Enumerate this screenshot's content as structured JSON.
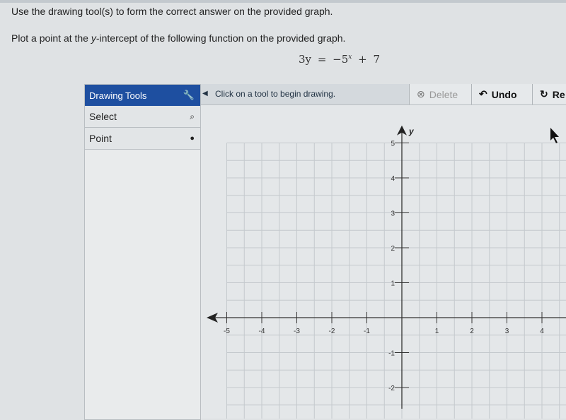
{
  "instructions": "Use the drawing tool(s) to form the correct answer on the provided graph.",
  "question": {
    "prefix": "Plot a point at the ",
    "var": "y",
    "suffix": "-intercept of the following function on the provided graph."
  },
  "equation": {
    "lhs": "3y",
    "eq": "=",
    "base": "−5",
    "exp": "x",
    "rest": "+ 7"
  },
  "tools": {
    "title": "Drawing Tools",
    "items": [
      {
        "label": "Select",
        "icon": "pointer-icon"
      },
      {
        "label": "Point",
        "icon": "dot-icon"
      }
    ]
  },
  "toolbar": {
    "message": "Click on a tool to begin drawing.",
    "delete": "Delete",
    "undo": "Undo",
    "redo": "Re"
  },
  "graph": {
    "x_range": [
      -5.5,
      4.7
    ],
    "y_range": [
      -2.8,
      5
    ],
    "x_ticks": [
      "-5",
      "-4",
      "-3",
      "-2",
      "-1",
      "1",
      "2",
      "3",
      "4"
    ],
    "y_ticks": [
      "5",
      "4",
      "3",
      "2",
      "1",
      "-1",
      "-2"
    ],
    "y_label": "y"
  }
}
